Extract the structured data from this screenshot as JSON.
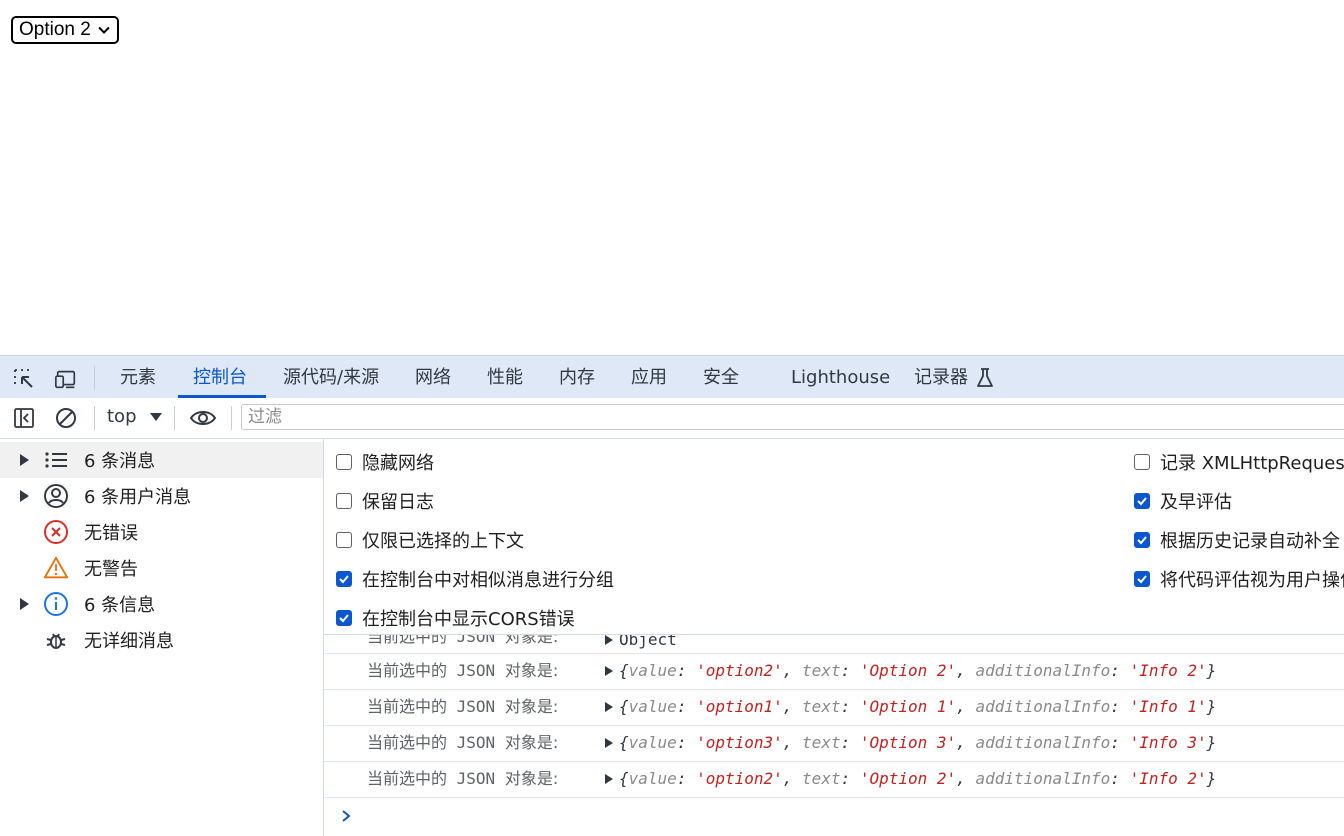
{
  "page": {
    "select_value": "Option 2"
  },
  "devtools": {
    "tabs": [
      "元素",
      "控制台",
      "源代码/来源",
      "网络",
      "性能",
      "内存",
      "应用",
      "安全",
      "Lighthouse",
      "记录器"
    ],
    "active_tab": "控制台",
    "accent_color": "#0b57d0",
    "toolbar": {
      "context": "top",
      "filter_placeholder": "过滤"
    },
    "sidebar": [
      {
        "label": "6 条消息",
        "icon": "list-icon",
        "expandable": true
      },
      {
        "label": "6 条用户消息",
        "icon": "user-circle-icon",
        "expandable": true
      },
      {
        "label": "无错误",
        "icon": "error-icon",
        "expandable": false
      },
      {
        "label": "无警告",
        "icon": "warning-icon",
        "expandable": false
      },
      {
        "label": "6 条信息",
        "icon": "info-icon",
        "expandable": true
      },
      {
        "label": "无详细消息",
        "icon": "bug-icon",
        "expandable": false
      }
    ],
    "settings_left": [
      {
        "label": "隐藏网络",
        "checked": false
      },
      {
        "label": "保留日志",
        "checked": false
      },
      {
        "label": "仅限已选择的上下文",
        "checked": false
      },
      {
        "label": "在控制台中对相似消息进行分组",
        "checked": true
      },
      {
        "label": "在控制台中显示CORS错误",
        "checked": true
      }
    ],
    "settings_right": [
      {
        "label": "记录 XMLHttpRequest",
        "checked": false
      },
      {
        "label": "及早评估",
        "checked": true
      },
      {
        "label": "根据历史记录自动补全",
        "checked": true
      },
      {
        "label": "将代码评估视为用户操作",
        "checked": true
      }
    ],
    "console": {
      "prefix_zh1": "当前选中的",
      "prefix_json": "JSON",
      "prefix_zh2": "对象是:",
      "first_partial": "Object",
      "entries": [
        {
          "value": "'option2'",
          "text": "'Option 2'",
          "additionalInfo": "'Info 2'"
        },
        {
          "value": "'option1'",
          "text": "'Option 1'",
          "additionalInfo": "'Info 1'"
        },
        {
          "value": "'option3'",
          "text": "'Option 3'",
          "additionalInfo": "'Info 3'"
        },
        {
          "value": "'option2'",
          "text": "'Option 2'",
          "additionalInfo": "'Info 2'"
        }
      ],
      "keys": {
        "value": "value",
        "text": "text",
        "info": "additionalInfo"
      }
    }
  }
}
